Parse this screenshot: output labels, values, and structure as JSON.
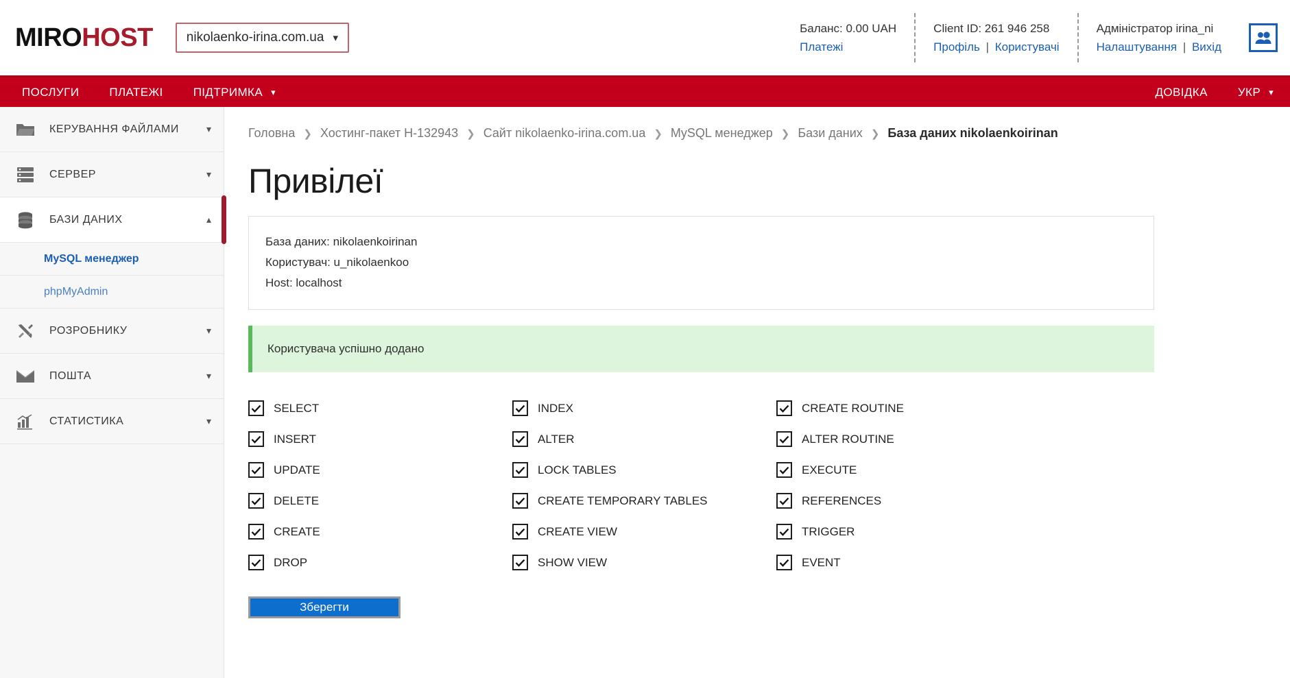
{
  "brand": {
    "part1": "MIRO",
    "part2": "HOST"
  },
  "domain_selector": {
    "value": "nikolaenko-irina.com.ua",
    "chevron": "chevron-down-icon"
  },
  "header_info": [
    {
      "line1": "Баланс: 0.00 UAH",
      "links": [
        {
          "label": "Платежі"
        }
      ]
    },
    {
      "line1": "Client ID: 261 946 258",
      "links": [
        {
          "label": "Профіль"
        },
        {
          "label": "Користувачі"
        }
      ]
    },
    {
      "line1": "Адміністратор irina_ni",
      "links": [
        {
          "label": "Налаштування"
        },
        {
          "label": "Вихід"
        }
      ]
    }
  ],
  "header_link_separator": "|",
  "users_icon": "users-icon",
  "nav": {
    "left": [
      {
        "label": "ПОСЛУГИ",
        "has_chevron": false
      },
      {
        "label": "ПЛАТЕЖІ",
        "has_chevron": false
      },
      {
        "label": "ПІДТРИМКА",
        "has_chevron": true
      }
    ],
    "right": [
      {
        "label": "ДОВІДКА",
        "has_chevron": false
      },
      {
        "label": "УКР",
        "has_chevron": true
      }
    ],
    "chevron": "⌄",
    "bg_color": "#c2001b"
  },
  "sidebar": {
    "items": [
      {
        "label": "КЕРУВАННЯ ФАЙЛАМИ",
        "icon": "folder-icon",
        "state": "collapsed",
        "chevron": "⌄"
      },
      {
        "label": "СЕРВЕР",
        "icon": "server-icon",
        "state": "collapsed",
        "chevron": "⌄"
      },
      {
        "label": "БАЗИ ДАНИХ",
        "icon": "database-icon",
        "state": "expanded",
        "chevron": "⌃"
      },
      {
        "label": "РОЗРОБНИКУ",
        "icon": "tools-icon",
        "state": "collapsed",
        "chevron": "⌄"
      },
      {
        "label": "ПОШТА",
        "icon": "mail-icon",
        "state": "collapsed",
        "chevron": "⌄"
      },
      {
        "label": "СТАТИСТИКА",
        "icon": "chart-icon",
        "state": "collapsed",
        "chevron": "⌄"
      }
    ],
    "sub_items": [
      {
        "label": "MySQL менеджер",
        "current": true
      },
      {
        "label": "phpMyAdmin",
        "current": false
      }
    ],
    "active_marker_color": "#9e1b2f"
  },
  "breadcrumb": {
    "separator": "❯",
    "items": [
      {
        "label": "Головна",
        "last": false
      },
      {
        "label": "Хостинг-пакет H-132943",
        "last": false
      },
      {
        "label": "Сайт nikolaenko-irina.com.ua",
        "last": false
      },
      {
        "label": "MySQL менеджер",
        "last": false
      },
      {
        "label": "Бази даних",
        "last": false
      },
      {
        "label": "База даних nikolaenkoirinan",
        "last": true
      }
    ]
  },
  "main": {
    "title": "Привілеї",
    "info": {
      "database": "База даних: nikolaenkoirinan",
      "user": "Користувач: u_nikolaenkoo",
      "host": "Host: localhost"
    },
    "alert": {
      "text": "Користувача успішно додано",
      "type": "success",
      "color": "#5cb85c"
    },
    "permissions": [
      {
        "label": "SELECT",
        "checked": true
      },
      {
        "label": "INDEX",
        "checked": true
      },
      {
        "label": "CREATE ROUTINE",
        "checked": true
      },
      {
        "label": "INSERT",
        "checked": true
      },
      {
        "label": "ALTER",
        "checked": true
      },
      {
        "label": "ALTER ROUTINE",
        "checked": true
      },
      {
        "label": "UPDATE",
        "checked": true
      },
      {
        "label": "LOCK TABLES",
        "checked": true
      },
      {
        "label": "EXECUTE",
        "checked": true
      },
      {
        "label": "DELETE",
        "checked": true
      },
      {
        "label": "CREATE TEMPORARY TABLES",
        "checked": true
      },
      {
        "label": "REFERENCES",
        "checked": true
      },
      {
        "label": "CREATE",
        "checked": true
      },
      {
        "label": "CREATE VIEW",
        "checked": true
      },
      {
        "label": "TRIGGER",
        "checked": true
      },
      {
        "label": "DROP",
        "checked": true
      },
      {
        "label": "SHOW VIEW",
        "checked": true
      },
      {
        "label": "EVENT",
        "checked": true
      }
    ],
    "save_button": {
      "label": "Зберегти",
      "color": "#0d6ecd"
    }
  }
}
